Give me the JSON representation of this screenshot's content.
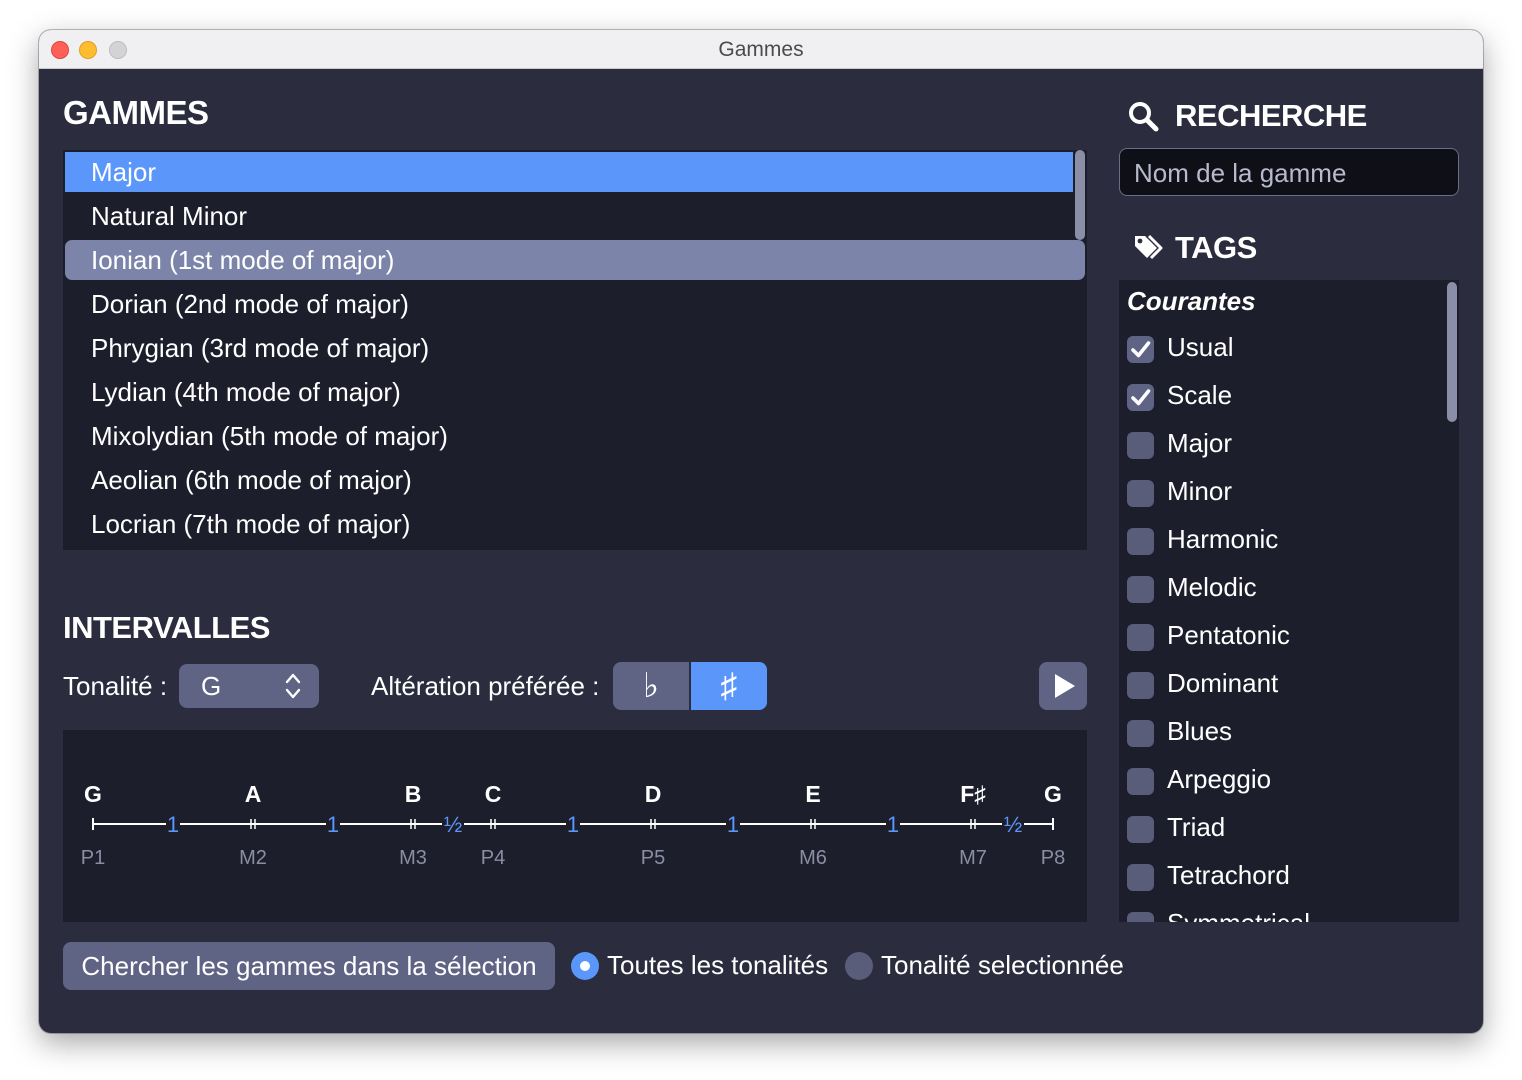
{
  "window": {
    "title": "Gammes"
  },
  "gammes": {
    "heading": "GAMMES",
    "items": [
      "Major",
      "Natural Minor",
      "Ionian (1st mode of major)",
      "Dorian (2nd mode of major)",
      "Phrygian (3rd mode of major)",
      "Lydian (4th mode of major)",
      "Mixolydian (5th mode of major)",
      "Aeolian (6th mode of major)",
      "Locrian (7th mode of major)"
    ],
    "selected": "Major"
  },
  "intervalles": {
    "heading": "INTERVALLES",
    "tonalite_label": "Tonalité :",
    "tonalite_value": "G",
    "alteration_label": "Altération préférée :",
    "flat": "♭",
    "sharp": "♯",
    "notes": [
      "G",
      "A",
      "B",
      "C",
      "D",
      "E",
      "F♯",
      "G"
    ],
    "steps": [
      "1",
      "1",
      "½",
      "1",
      "1",
      "1",
      "½"
    ],
    "degrees": [
      "P1",
      "M2",
      "M3",
      "P4",
      "P5",
      "M6",
      "M7",
      "P8"
    ],
    "note_semitones": [
      0,
      2,
      4,
      5,
      7,
      9,
      11,
      12
    ]
  },
  "recherche": {
    "heading": "RECHERCHE",
    "placeholder": "Nom de la gamme"
  },
  "tags": {
    "heading": "TAGS",
    "group": "Courantes",
    "items": [
      {
        "label": "Usual",
        "checked": true
      },
      {
        "label": "Scale",
        "checked": true
      },
      {
        "label": "Major",
        "checked": false
      },
      {
        "label": "Minor",
        "checked": false
      },
      {
        "label": "Harmonic",
        "checked": false
      },
      {
        "label": "Melodic",
        "checked": false
      },
      {
        "label": "Pentatonic",
        "checked": false
      },
      {
        "label": "Dominant",
        "checked": false
      },
      {
        "label": "Blues",
        "checked": false
      },
      {
        "label": "Arpeggio",
        "checked": false
      },
      {
        "label": "Triad",
        "checked": false
      },
      {
        "label": "Tetrachord",
        "checked": false
      },
      {
        "label": "Symmetrical",
        "checked": false
      }
    ]
  },
  "footer": {
    "search_button": "Chercher les gammes dans la sélection",
    "radio_all": "Toutes les tonalités",
    "radio_selected": "Tonalité selectionnée"
  },
  "colors": {
    "accent": "#5b97fb",
    "panel": "#1d1e2b",
    "background": "#2b2c3d",
    "control": "#5f6485"
  }
}
